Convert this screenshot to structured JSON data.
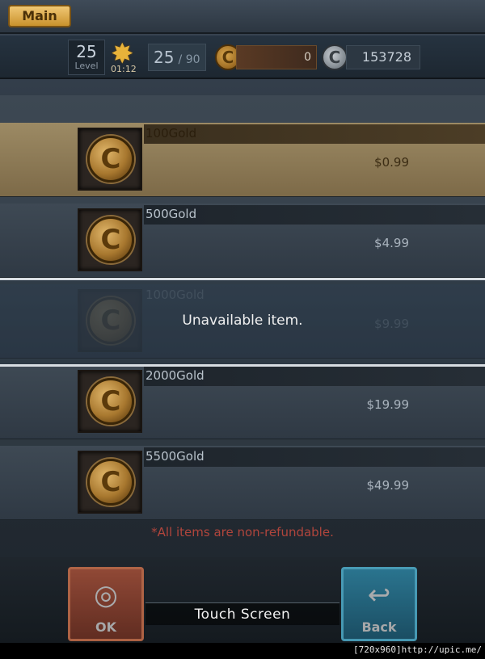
{
  "top_tab": {
    "label": "Main"
  },
  "status": {
    "level_value": "25",
    "level_label": "Level",
    "stamina_timer": "01:12",
    "stamina_current": "25",
    "stamina_max": "/ 90",
    "gold": "0",
    "silver": "153728"
  },
  "shop": {
    "items": [
      {
        "name": "100Gold",
        "price": "$0.99",
        "state": "selected"
      },
      {
        "name": "500Gold",
        "price": "$4.99",
        "state": "normal"
      },
      {
        "name": "1000Gold",
        "price": "$9.99",
        "state": "unavailable"
      },
      {
        "name": "2000Gold",
        "price": "$19.99",
        "state": "normal"
      },
      {
        "name": "5500Gold",
        "price": "$49.99",
        "state": "normal"
      }
    ]
  },
  "popup": {
    "message": "Unavailable item."
  },
  "notice": "*All items are non-refundable.",
  "buttons": {
    "ok": "OK",
    "back": "Back"
  },
  "touch_prompt": "Touch Screen",
  "watermark": "[720x960]http://upic.me/",
  "icons": {
    "coin_glyph": "C",
    "star": "star-icon",
    "ok": "ok-icon",
    "back": "back-arrow-icon"
  },
  "colors": {
    "gold_accent": "#e8b33a",
    "notice_red": "#b0453c",
    "ok_button": "#b7553a",
    "back_button": "#2f8fb0"
  }
}
